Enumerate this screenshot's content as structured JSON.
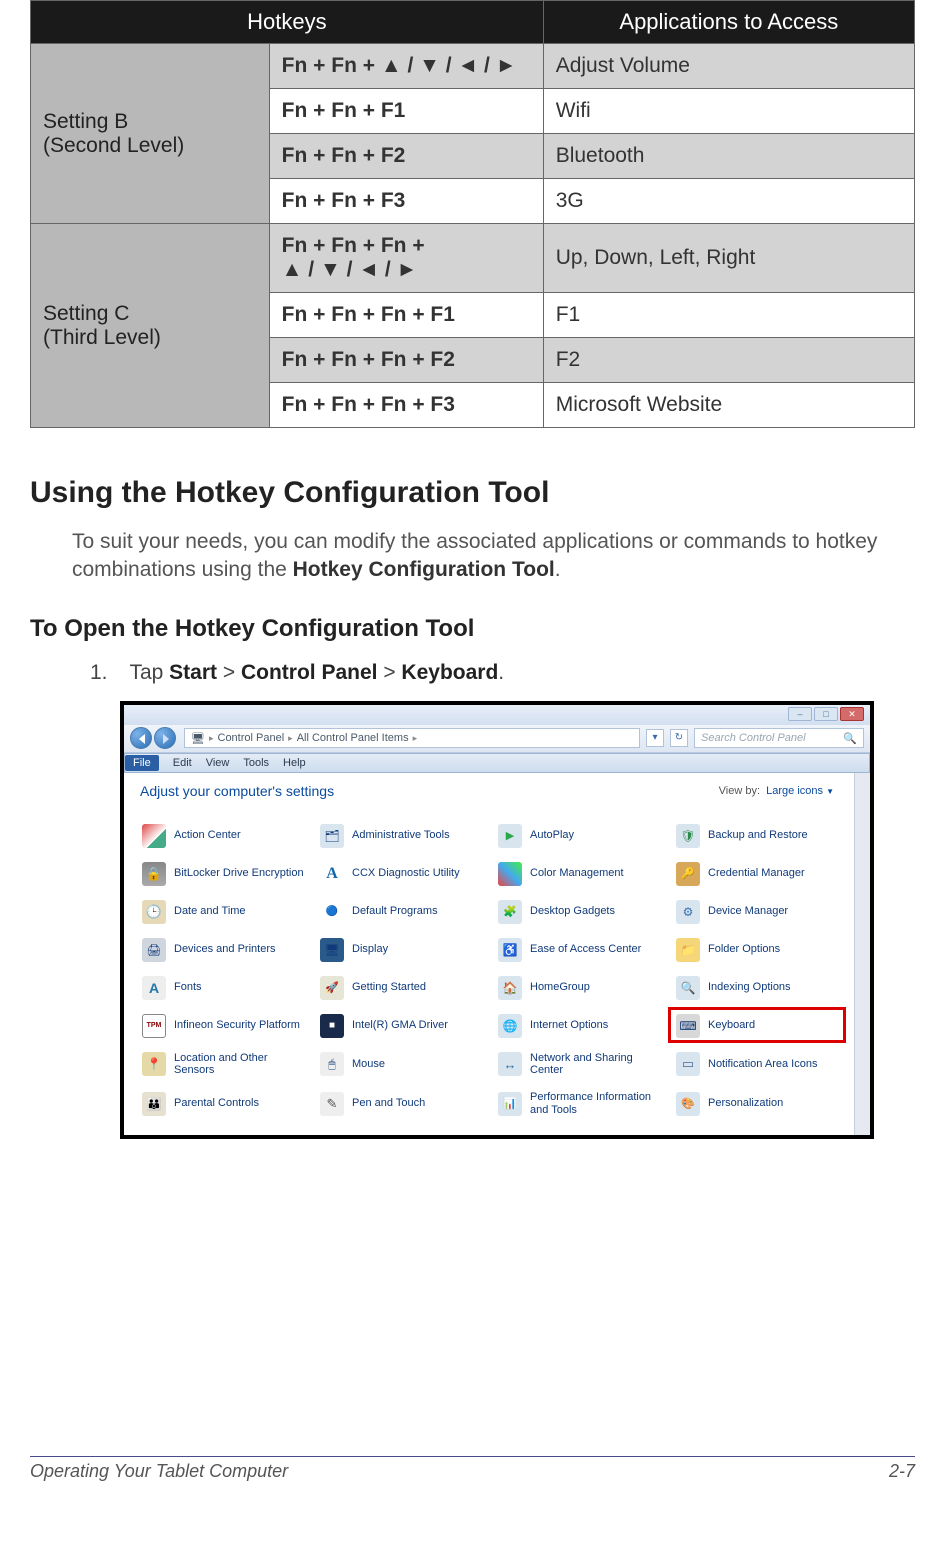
{
  "table": {
    "headers": [
      "Hotkeys",
      "Applications to Access"
    ],
    "groups": [
      {
        "label": "Setting B\n(Second Level)",
        "rows": [
          {
            "hotkey": "Fn + Fn + ▲ / ▼ / ◄ / ►",
            "app": "Adjust Volume"
          },
          {
            "hotkey": "Fn + Fn + F1",
            "app": "Wifi"
          },
          {
            "hotkey": "Fn + Fn + F2",
            "app": "Bluetooth"
          },
          {
            "hotkey": "Fn + Fn + F3",
            "app": "3G"
          }
        ]
      },
      {
        "label": "Setting C\n(Third Level)",
        "rows": [
          {
            "hotkey": "Fn + Fn + Fn +\n▲ / ▼ / ◄ / ►",
            "app": "Up, Down, Left, Right"
          },
          {
            "hotkey": "Fn + Fn + Fn + F1",
            "app": "F1"
          },
          {
            "hotkey": "Fn + Fn + Fn + F2",
            "app": "F2"
          },
          {
            "hotkey": "Fn + Fn + Fn + F3",
            "app": "Microsoft Website"
          }
        ]
      }
    ]
  },
  "section_heading": "Using the Hotkey Configuration Tool",
  "section_para_pre": "To suit your needs, you can modify the associated applications or commands to hotkey combinations using the ",
  "section_para_bold": "Hotkey Configuration Tool",
  "section_para_post": ".",
  "sub_heading": "To Open the Hotkey Configuration Tool",
  "step": {
    "num": "1.",
    "pre": "Tap ",
    "b1": "Start",
    "sep1": " > ",
    "b2": "Control Panel",
    "sep2": " > ",
    "b3": "Keyboard",
    "post": "."
  },
  "screenshot": {
    "breadcrumb": [
      "Control Panel",
      "All Control Panel Items"
    ],
    "search_placeholder": "Search Control Panel",
    "menu": {
      "file": "File",
      "edit": "Edit",
      "view": "View",
      "tools": "Tools",
      "help": "Help"
    },
    "adjust_text": "Adjust your computer's settings",
    "viewby_label": "View by:",
    "viewby_value": "Large icons",
    "items": [
      {
        "name": "Action Center",
        "ico": "ic-flag"
      },
      {
        "name": "Administrative Tools",
        "ico": "ic-admin"
      },
      {
        "name": "AutoPlay",
        "ico": "ic-auto"
      },
      {
        "name": "Backup and Restore",
        "ico": "ic-backup"
      },
      {
        "name": "BitLocker Drive Encryption",
        "ico": "ic-lock"
      },
      {
        "name": "CCX Diagnostic Utility",
        "ico": "ic-ccx"
      },
      {
        "name": "Color Management",
        "ico": "ic-color"
      },
      {
        "name": "Credential Manager",
        "ico": "ic-cred"
      },
      {
        "name": "Date and Time",
        "ico": "ic-clock"
      },
      {
        "name": "Default Programs",
        "ico": "ic-default"
      },
      {
        "name": "Desktop Gadgets",
        "ico": "ic-gadget"
      },
      {
        "name": "Device Manager",
        "ico": "ic-devmgr"
      },
      {
        "name": "Devices and Printers",
        "ico": "ic-print"
      },
      {
        "name": "Display",
        "ico": "ic-display"
      },
      {
        "name": "Ease of Access Center",
        "ico": "ic-ease"
      },
      {
        "name": "Folder Options",
        "ico": "ic-folder"
      },
      {
        "name": "Fonts",
        "ico": "ic-font"
      },
      {
        "name": "Getting Started",
        "ico": "ic-start"
      },
      {
        "name": "HomeGroup",
        "ico": "ic-home"
      },
      {
        "name": "Indexing Options",
        "ico": "ic-index"
      },
      {
        "name": "Infineon Security Platform",
        "ico": "ic-tpm"
      },
      {
        "name": "Intel(R) GMA Driver",
        "ico": "ic-intel"
      },
      {
        "name": "Internet Options",
        "ico": "ic-inet"
      },
      {
        "name": "Keyboard",
        "ico": "ic-kbd",
        "highlight": true
      },
      {
        "name": "Location and Other Sensors",
        "ico": "ic-loc"
      },
      {
        "name": "Mouse",
        "ico": "ic-mouse"
      },
      {
        "name": "Network and Sharing Center",
        "ico": "ic-net"
      },
      {
        "name": "Notification Area Icons",
        "ico": "ic-notif"
      },
      {
        "name": "Parental Controls",
        "ico": "ic-parent"
      },
      {
        "name": "Pen and Touch",
        "ico": "ic-pen"
      },
      {
        "name": "Performance Information and Tools",
        "ico": "ic-perf"
      },
      {
        "name": "Personalization",
        "ico": "ic-pers"
      }
    ]
  },
  "footer": {
    "left": "Operating Your Tablet Computer",
    "right": "2-7"
  }
}
